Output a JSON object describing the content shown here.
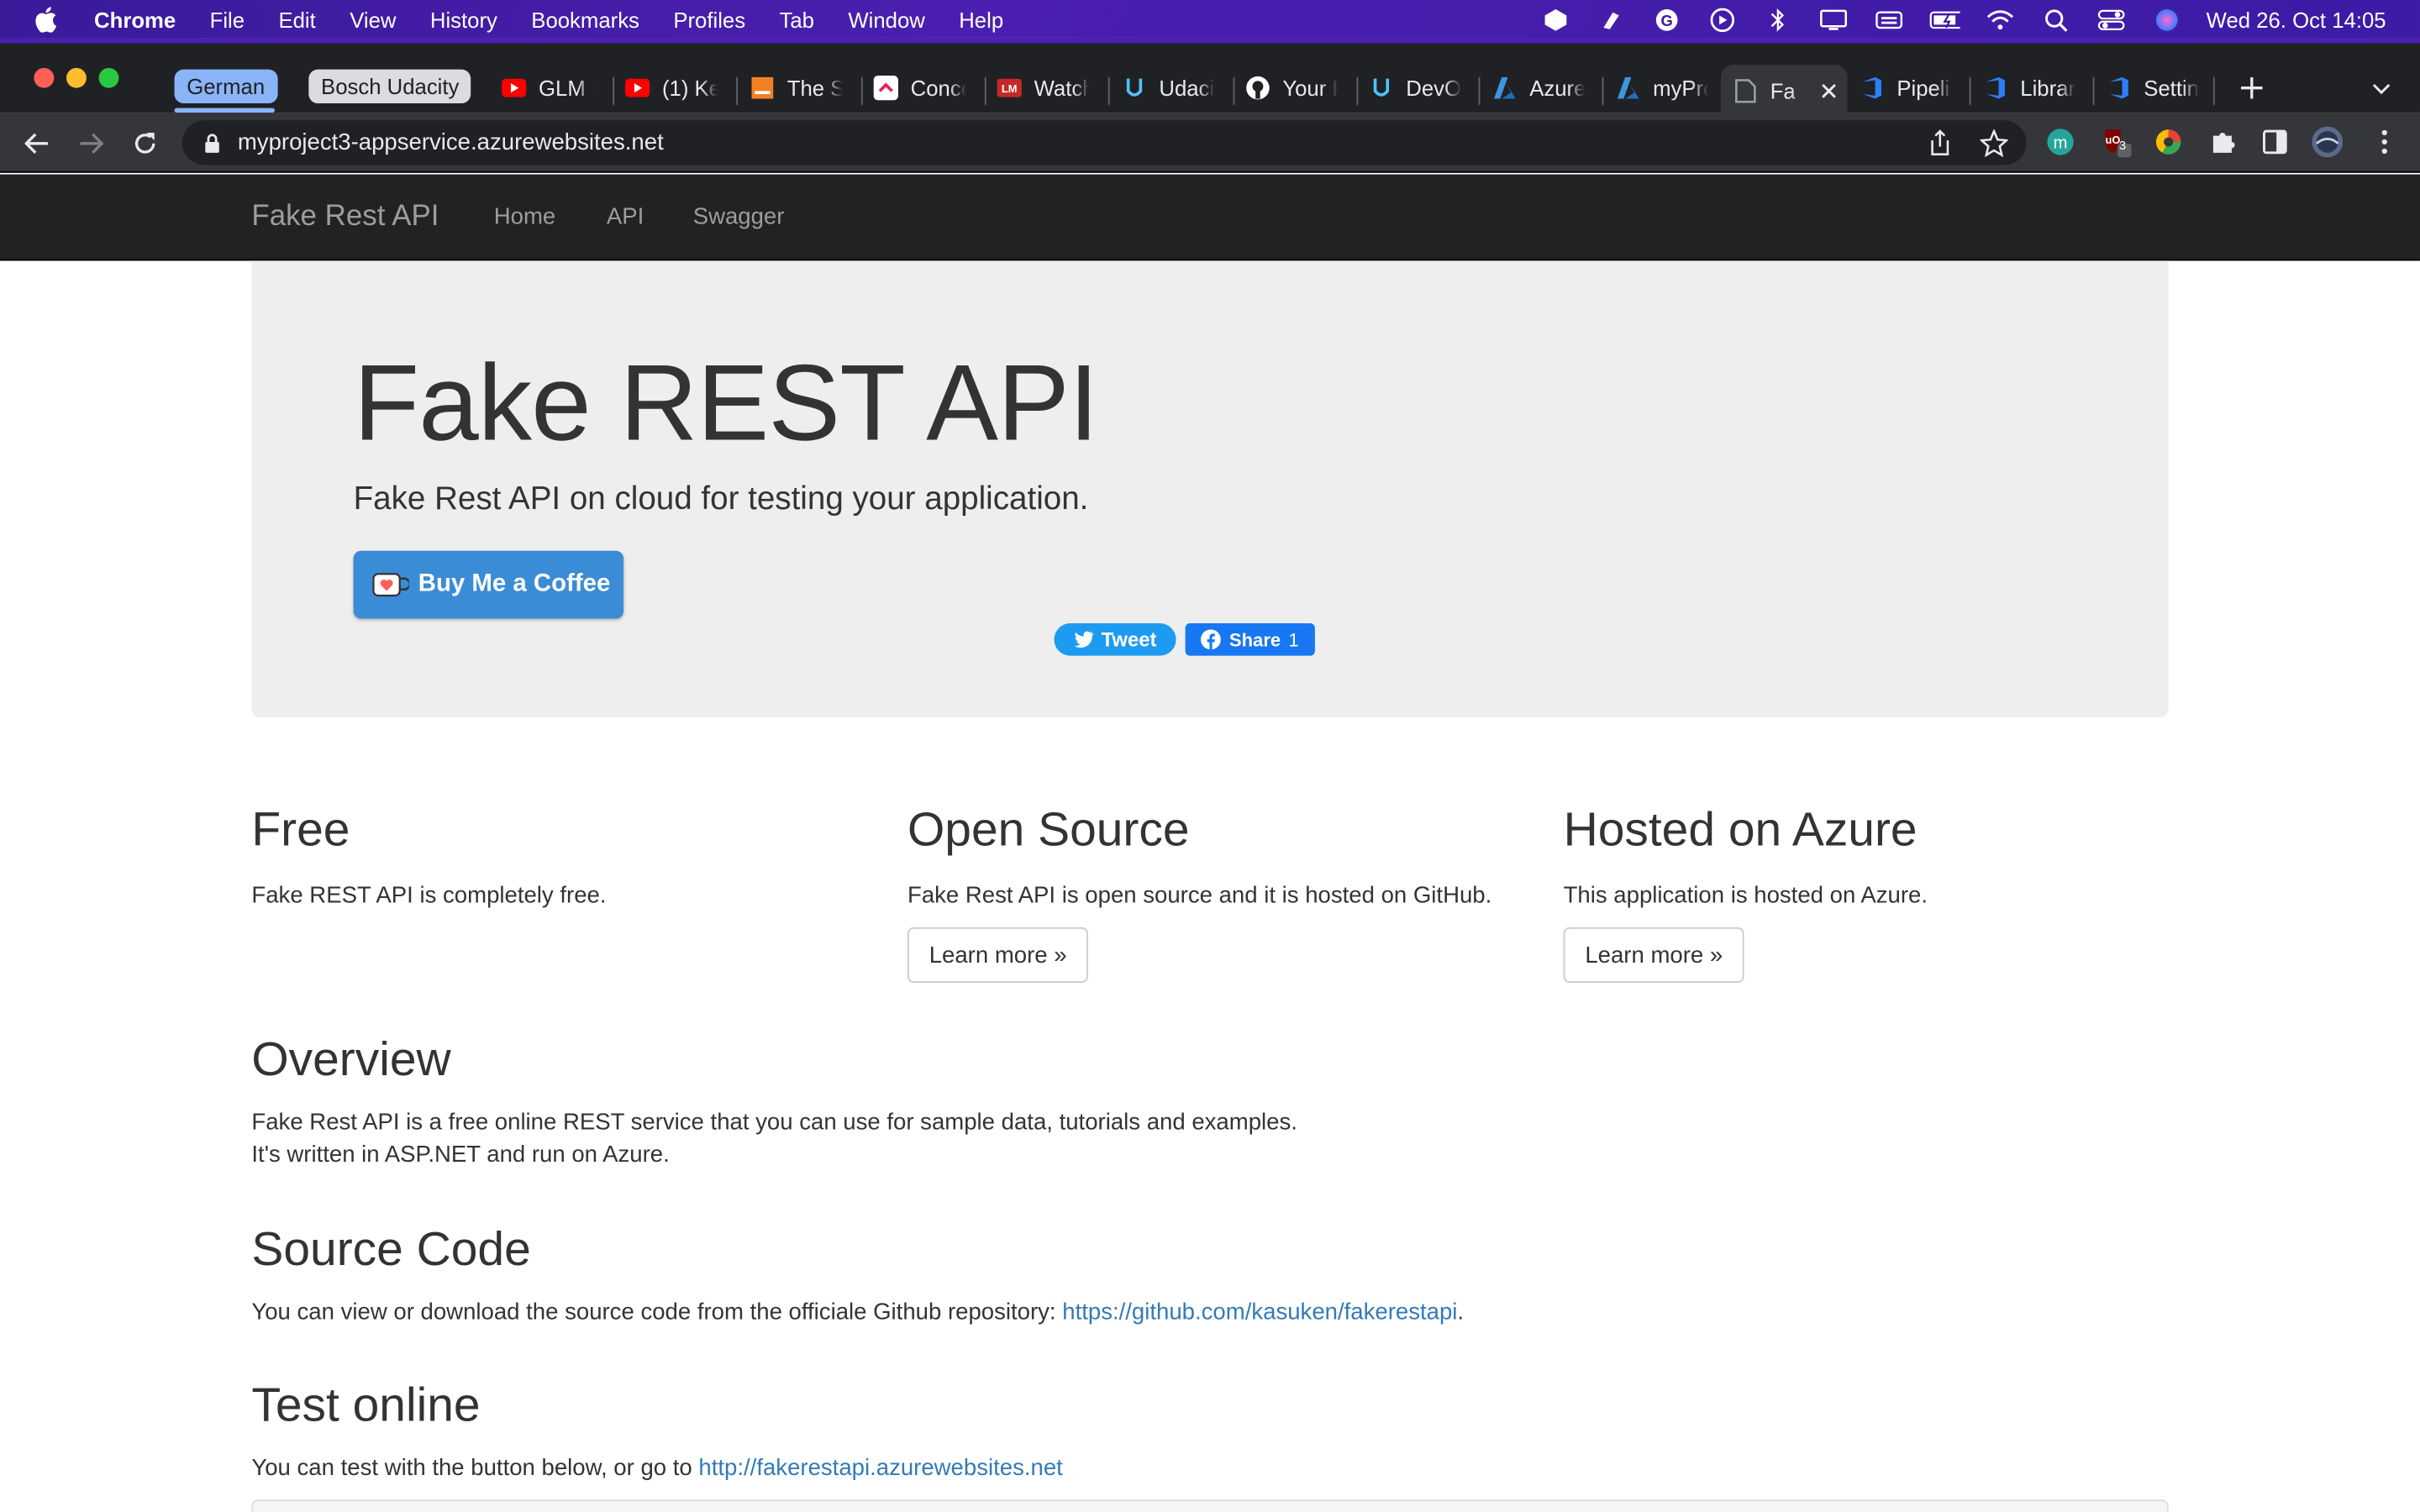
{
  "menubar": {
    "app_name": "Chrome",
    "items": [
      "File",
      "Edit",
      "View",
      "History",
      "Bookmarks",
      "Profiles",
      "Tab",
      "Window",
      "Help"
    ],
    "clock": "Wed 26. Oct  14:05"
  },
  "tabstrip": {
    "groups": [
      {
        "label": "German",
        "color": "#8ab4f8"
      },
      {
        "label": "Bosch Udacity",
        "color": "#dadce0"
      }
    ],
    "tabs": [
      {
        "label": "GLM I",
        "icon": "youtube-icon"
      },
      {
        "label": "(1) Ke",
        "icon": "youtube-icon"
      },
      {
        "label": "The S",
        "icon": "stackoverflow-icon"
      },
      {
        "label": "Conce",
        "icon": "clickup-icon"
      },
      {
        "label": "Watch",
        "icon": "lm-icon"
      },
      {
        "label": "Udaci",
        "icon": "udacity-icon"
      },
      {
        "label": "Your F",
        "icon": "github-icon"
      },
      {
        "label": "DevOp",
        "icon": "udacity-icon"
      },
      {
        "label": "Azure",
        "icon": "azure-icon"
      },
      {
        "label": "myPro",
        "icon": "azure-icon"
      },
      {
        "label": "Fa",
        "icon": "page-icon",
        "active": true
      },
      {
        "label": "Pipeli",
        "icon": "azure-devops-icon"
      },
      {
        "label": "Librar",
        "icon": "azure-devops-icon"
      },
      {
        "label": "Settin",
        "icon": "azure-devops-icon"
      }
    ]
  },
  "toolbar": {
    "url": "myproject3-appservice.azurewebsites.net",
    "extension_badge": "3"
  },
  "site": {
    "brand": "Fake Rest API",
    "nav": [
      "Home",
      "API",
      "Swagger"
    ],
    "jumbotron": {
      "title": "Fake REST API",
      "subtitle": "Fake Rest API on cloud for testing your application.",
      "coffee_button": "Buy Me a Coffee",
      "tweet_button": "Tweet",
      "share_button": "Share",
      "share_count": "1"
    },
    "features": [
      {
        "title": "Free",
        "text": "Fake REST API is completely free.",
        "button": ""
      },
      {
        "title": "Open Source",
        "text": "Fake Rest API is open source and it is hosted on GitHub.",
        "button": "Learn more »"
      },
      {
        "title": "Hosted on Azure",
        "text": "This application is hosted on Azure.",
        "button": "Learn more »"
      }
    ],
    "overview": {
      "title": "Overview",
      "line1": "Fake Rest API is a free online REST service that you can use for sample data, tutorials and examples.",
      "line2": "It's written in ASP.NET and run on Azure."
    },
    "source_code": {
      "title": "Source Code",
      "text": "You can view or download the source code from the officiale Github repository: ",
      "link": "https://github.com/kasuken/fakerestapi",
      "suffix": "."
    },
    "test_online": {
      "title": "Test online",
      "text": "You can test with the button below, or go to ",
      "link": "http://fakerestapi.azurewebsites.net"
    }
  }
}
